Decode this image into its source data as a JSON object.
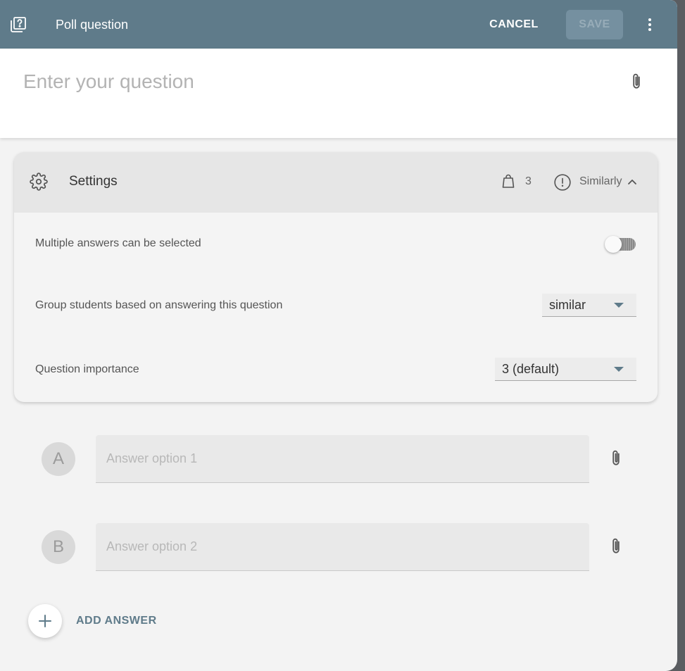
{
  "header": {
    "title": "Poll question",
    "cancel_label": "CANCEL",
    "save_label": "SAVE",
    "icons": {
      "type": "quiz-icon",
      "more": "more-vertical-icon"
    },
    "colors": {
      "bar": "#5f7b8a",
      "save_disabled_bg": "#7590a0",
      "save_disabled_text": "#97acb8"
    }
  },
  "question": {
    "placeholder": "Enter your question",
    "value": "",
    "attach_icon": "paperclip-icon"
  },
  "settings": {
    "title": "Settings",
    "importance_badge": "3",
    "grouping_badge": "Similarly",
    "expanded": true,
    "multiple_answers": {
      "label": "Multiple answers can be selected",
      "enabled": false
    },
    "grouping": {
      "label": "Group students based on answering this question",
      "selected": "similar"
    },
    "importance": {
      "label": "Question importance",
      "selected": "3 (default)"
    }
  },
  "answers": [
    {
      "letter": "A",
      "placeholder": "Answer option 1",
      "value": ""
    },
    {
      "letter": "B",
      "placeholder": "Answer option 2",
      "value": ""
    }
  ],
  "add_answer_label": "ADD ANSWER"
}
